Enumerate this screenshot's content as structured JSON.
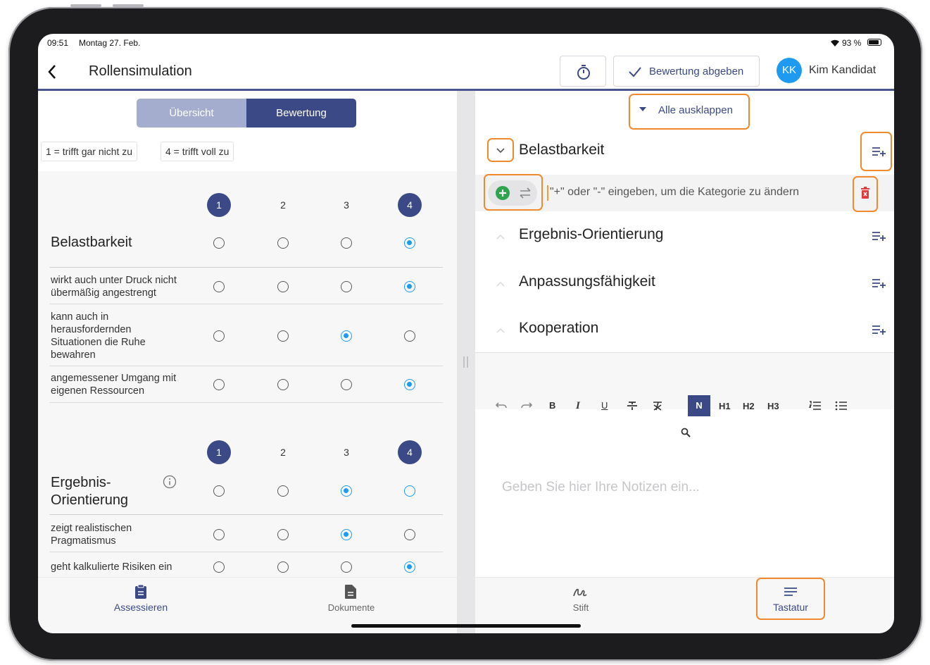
{
  "status": {
    "time": "09:51",
    "date": "Montag 27. Feb.",
    "battery": "93 %"
  },
  "header": {
    "title": "Rollensimulation",
    "submit_label": "Bewertung abgeben",
    "user_initials": "KK",
    "user_name": "Kim Kandidat"
  },
  "left": {
    "segments": [
      "Übersicht",
      "Bewertung"
    ],
    "legend_low": "1 = trifft gar nicht zu",
    "legend_high": "4 = trifft voll zu",
    "scale": [
      "1",
      "2",
      "3",
      "4"
    ],
    "groups": [
      {
        "title": "Belastbarkeit",
        "overall_selected": 4,
        "criteria": [
          {
            "text": "wirkt auch unter Druck nicht übermäßig angestrengt",
            "selected": 4
          },
          {
            "text": "kann auch in herausfordernden Situationen die Ruhe bewahren",
            "selected": 3
          },
          {
            "text": "angemessener Umgang mit eigenen Ressourcen",
            "selected": 4
          }
        ]
      },
      {
        "title": "Ergebnis-Orientierung",
        "overall_selected": 3,
        "criteria": [
          {
            "text": "zeigt realistischen Pragmatismus",
            "selected": 3
          },
          {
            "text": "geht kalkulierte Risiken ein",
            "selected": 4
          }
        ]
      }
    ]
  },
  "right": {
    "expand_all": "Alle ausklappen",
    "categories": [
      "Belastbarkeit",
      "Ergebnis-Orientierung",
      "Anpassungsfähigkeit",
      "Kooperation"
    ],
    "category_hint": "\"+\" oder \"-\" eingeben, um die Kategorie zu ändern",
    "toolbar": {
      "normal": "N",
      "h1": "H1",
      "h2": "H2",
      "h3": "H3",
      "bold": "B",
      "italic": "I",
      "underline": "U"
    },
    "notes_placeholder": "Geben Sie hier Ihre Notizen ein..."
  },
  "bottom_nav": {
    "left": [
      {
        "label": "Assessieren",
        "icon": "clipboard-icon",
        "active": true
      },
      {
        "label": "Dokumente",
        "icon": "document-icon",
        "active": false
      }
    ],
    "right": [
      {
        "label": "Stift",
        "icon": "pen-icon",
        "active": false
      },
      {
        "label": "Tastatur",
        "icon": "keyboard-lines-icon",
        "active": true
      }
    ]
  },
  "colors": {
    "accent": "#3b4a86",
    "radio": "#1e9bf0",
    "highlight": "#f08a2c",
    "delete": "#e03b3b",
    "add": "#2ea44f"
  }
}
